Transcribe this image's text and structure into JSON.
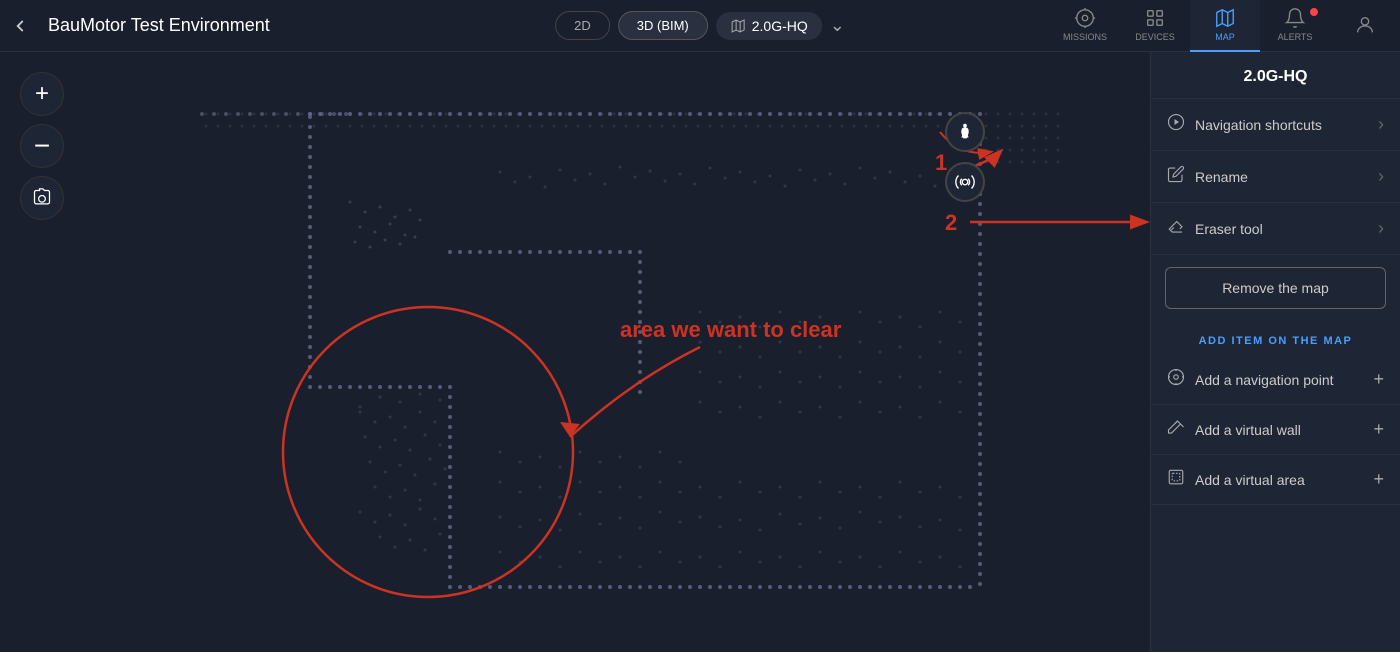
{
  "header": {
    "back_icon": "←",
    "title": "BauMotor Test Environment",
    "view_2d": "2D",
    "view_3d": "3D (BIM)",
    "map_name": "2.0G-HQ",
    "chevron": "⌄"
  },
  "nav": {
    "missions": {
      "label": "MISSIONS",
      "icon": "missions"
    },
    "devices": {
      "label": "DEVICES",
      "icon": "devices"
    },
    "map": {
      "label": "MAP",
      "icon": "map",
      "active": true
    },
    "alerts": {
      "label": "ALERTS",
      "icon": "alerts"
    },
    "profile": {
      "label": "",
      "icon": "profile"
    }
  },
  "map_controls": {
    "zoom_in": "+",
    "zoom_out": "−",
    "camera": "📷"
  },
  "sidebar": {
    "title": "2.0G-HQ",
    "menu_items": [
      {
        "id": "navigation-shortcuts",
        "label": "Navigation shortcuts",
        "icon": "nav"
      },
      {
        "id": "rename",
        "label": "Rename",
        "icon": "edit"
      },
      {
        "id": "eraser-tool",
        "label": "Eraser tool",
        "icon": "eraser"
      }
    ],
    "remove_map_btn": "Remove the map",
    "add_section_title": "ADD ITEM ON THE MAP",
    "add_items": [
      {
        "id": "add-nav-point",
        "label": "Add a navigation point",
        "icon": "nav-point"
      },
      {
        "id": "add-virtual-wall",
        "label": "Add a virtual wall",
        "icon": "wall"
      },
      {
        "id": "add-virtual-area",
        "label": "Add a virtual area",
        "icon": "area"
      }
    ]
  },
  "annotations": {
    "number1": "1",
    "number2": "2",
    "text": "area we want to clear"
  },
  "colors": {
    "accent": "#cc3322",
    "blue": "#4a9eff",
    "bg_dark": "#1a1f2e",
    "bg_panel": "#1e2535",
    "border": "#2a3040"
  }
}
